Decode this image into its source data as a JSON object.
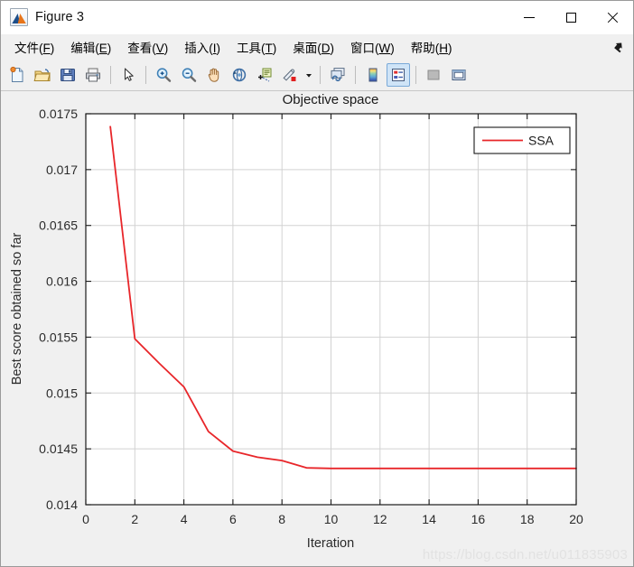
{
  "window": {
    "title": "Figure 3",
    "icon": "matlab-figure-icon",
    "controls": {
      "minimize": "minimize-button",
      "maximize": "maximize-button",
      "close": "close-button"
    }
  },
  "menubar": {
    "items": [
      {
        "label": "文件(F)",
        "text": "文件(",
        "accel": "F",
        "tail": ")"
      },
      {
        "label": "编辑(E)",
        "text": "编辑(",
        "accel": "E",
        "tail": ")"
      },
      {
        "label": "查看(V)",
        "text": "查看(",
        "accel": "V",
        "tail": ")"
      },
      {
        "label": "插入(I)",
        "text": "插入(",
        "accel": "I",
        "tail": ")"
      },
      {
        "label": "工具(T)",
        "text": "工具(",
        "accel": "T",
        "tail": ")"
      },
      {
        "label": "桌面(D)",
        "text": "桌面(",
        "accel": "D",
        "tail": ")"
      },
      {
        "label": "窗口(W)",
        "text": "窗口(",
        "accel": "W",
        "tail": ")"
      },
      {
        "label": "帮助(H)",
        "text": "帮助(",
        "accel": "H",
        "tail": ")"
      }
    ],
    "dock_icon": "undock-arrow-icon"
  },
  "toolbar": {
    "buttons": [
      {
        "name": "new-figure-icon",
        "active": false
      },
      {
        "name": "open-file-icon",
        "active": false
      },
      {
        "name": "save-figure-icon",
        "active": false
      },
      {
        "name": "print-figure-icon",
        "active": false
      },
      {
        "name": "pointer-arrow-icon",
        "active": false
      },
      {
        "name": "zoom-in-icon",
        "active": false
      },
      {
        "name": "zoom-out-icon",
        "active": false
      },
      {
        "name": "pan-hand-icon",
        "active": false
      },
      {
        "name": "rotate-3d-icon",
        "active": false
      },
      {
        "name": "data-cursor-icon",
        "active": false
      },
      {
        "name": "brush-data-icon",
        "active": false
      },
      {
        "name": "brush-dropdown-icon",
        "active": false
      },
      {
        "name": "link-data-icon",
        "active": false
      },
      {
        "name": "colorbar-icon",
        "active": false
      },
      {
        "name": "legend-icon",
        "active": true
      },
      {
        "name": "hide-plot-tools-icon",
        "active": false
      },
      {
        "name": "show-plot-tools-icon",
        "active": false
      }
    ]
  },
  "watermark": "https://blog.csdn.net/u011835903",
  "chart_data": {
    "type": "line",
    "title": "Objective space",
    "xlabel": "Iteration",
    "ylabel": "Best score obtained so far",
    "xlim": [
      0,
      20
    ],
    "ylim": [
      0.014,
      0.0175
    ],
    "xticks": [
      0,
      2,
      4,
      6,
      8,
      10,
      12,
      14,
      16,
      18,
      20
    ],
    "xticklabels": [
      "0",
      "2",
      "4",
      "6",
      "8",
      "10",
      "12",
      "14",
      "16",
      "18",
      "20"
    ],
    "yticks": [
      0.014,
      0.0145,
      0.015,
      0.0155,
      0.016,
      0.0165,
      0.017,
      0.0175
    ],
    "yticklabels": [
      "0.014",
      "0.0145",
      "0.015",
      "0.0155",
      "0.016",
      "0.0165",
      "0.017",
      "0.0175"
    ],
    "grid": true,
    "legend": {
      "position": "top-right",
      "entries": [
        "SSA"
      ]
    },
    "series": [
      {
        "name": "SSA",
        "color": "#e8262a",
        "x": [
          1,
          2,
          3,
          4,
          5,
          6,
          7,
          8,
          9,
          10,
          11,
          12,
          13,
          14,
          15,
          16,
          17,
          18,
          19,
          20
        ],
        "values": [
          0.017385,
          0.015485,
          0.015265,
          0.015055,
          0.014655,
          0.01448,
          0.014425,
          0.014395,
          0.01433,
          0.014325,
          0.014325,
          0.014325,
          0.014325,
          0.014325,
          0.014325,
          0.014325,
          0.014325,
          0.014325,
          0.014325,
          0.014325
        ]
      }
    ]
  }
}
